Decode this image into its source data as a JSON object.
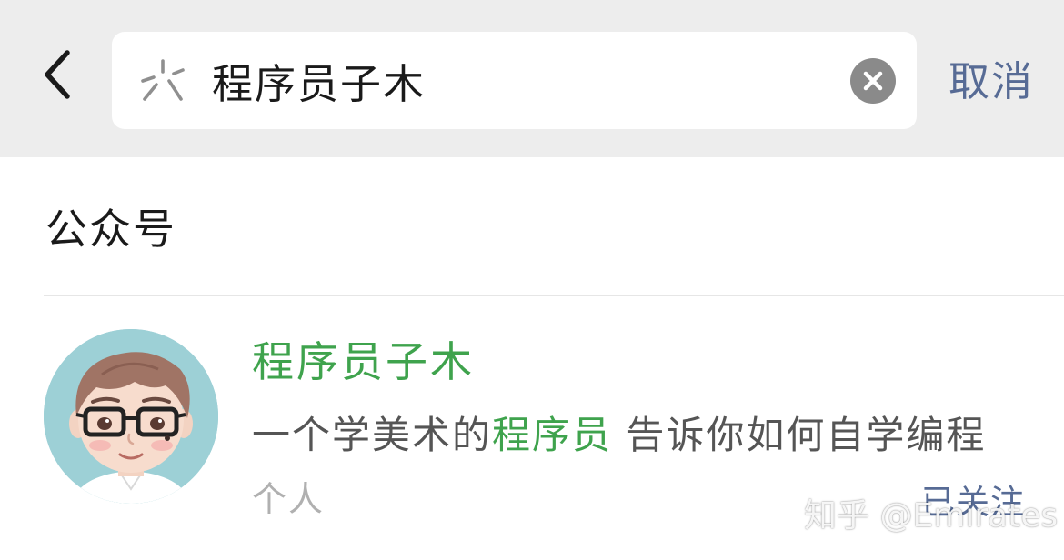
{
  "search": {
    "query": "程序员子木",
    "cancel_label": "取消"
  },
  "section": {
    "title": "公众号"
  },
  "result": {
    "name": "程序员子木",
    "description_prefix": "一个学美术的",
    "description_highlight": "程序员",
    "description_suffix": " 告诉你如何自学编程",
    "type": "个人",
    "follow_status": "已关注"
  },
  "watermark": {
    "text": "知乎 @Emirates"
  },
  "colors": {
    "highlight_green": "#3fa34d",
    "link_blue": "#576b95",
    "top_bar_bg": "#ededed"
  },
  "icons": {
    "back": "chevron-left-icon",
    "search_logo": "search-logo-icon",
    "clear": "clear-circle-x-icon"
  }
}
